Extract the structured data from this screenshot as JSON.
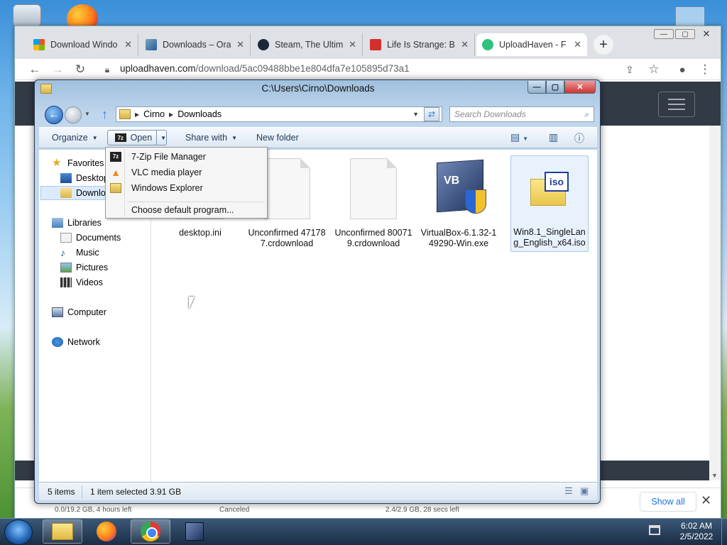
{
  "chrome": {
    "tabs": [
      {
        "title": "Download Windo",
        "favicon": "windows-logo",
        "color": "#f25022"
      },
      {
        "title": "Downloads – Ora",
        "favicon": "oracle-chart",
        "color": "#3a6ea8"
      },
      {
        "title": "Steam, The Ultim",
        "favicon": "steam-logo",
        "color": "#1b2838"
      },
      {
        "title": "Life Is Strange: Be",
        "favicon": "lock-icon",
        "color": "#d32f2f"
      },
      {
        "title": "UploadHaven - F",
        "favicon": "uploadhaven-logo",
        "color": "#2ec27e"
      }
    ],
    "new_tab": "+",
    "url_host": "uploadhaven.com",
    "url_path": "/download/5ac09488bbe1e804dfa7e105895d73a1"
  },
  "downloads": {
    "item1_status": "0.0/19.2 GB, 4 hours left",
    "item2_status": "Canceled",
    "item3_status": "2.4/2.9 GB, 28 secs left",
    "show_all": "Show all"
  },
  "explorer": {
    "title": "C:\\Users\\Cirno\\Downloads",
    "breadcrumb": [
      "Cirno",
      "Downloads"
    ],
    "search_placeholder": "Search Downloads",
    "toolbar": {
      "organize": "Organize",
      "open": "Open",
      "share_with": "Share with",
      "new_folder": "New folder"
    },
    "nav": {
      "favorites": "Favorites",
      "desktop": "Desktop",
      "downloads": "Downloads",
      "libraries": "Libraries",
      "documents": "Documents",
      "music": "Music",
      "pictures": "Pictures",
      "videos": "Videos",
      "computer": "Computer",
      "network": "Network"
    },
    "files": [
      {
        "name": "desktop.ini"
      },
      {
        "name": "Unconfirmed 471787.crdownload"
      },
      {
        "name": "Unconfirmed 800719.crdownload"
      },
      {
        "name": "VirtualBox-6.1.32-149290-Win.exe"
      },
      {
        "name": "Win8.1_SingleLang_English_x64.iso"
      }
    ],
    "open_menu": {
      "items": [
        "7-Zip File Manager",
        "VLC media player",
        "Windows Explorer"
      ],
      "choose_default": "Choose default program..."
    },
    "status": {
      "items": "5 items",
      "selected": "1 item selected  3.91 GB"
    }
  },
  "taskbar": {
    "time": "6:02 AM",
    "date": "2/5/2022"
  }
}
